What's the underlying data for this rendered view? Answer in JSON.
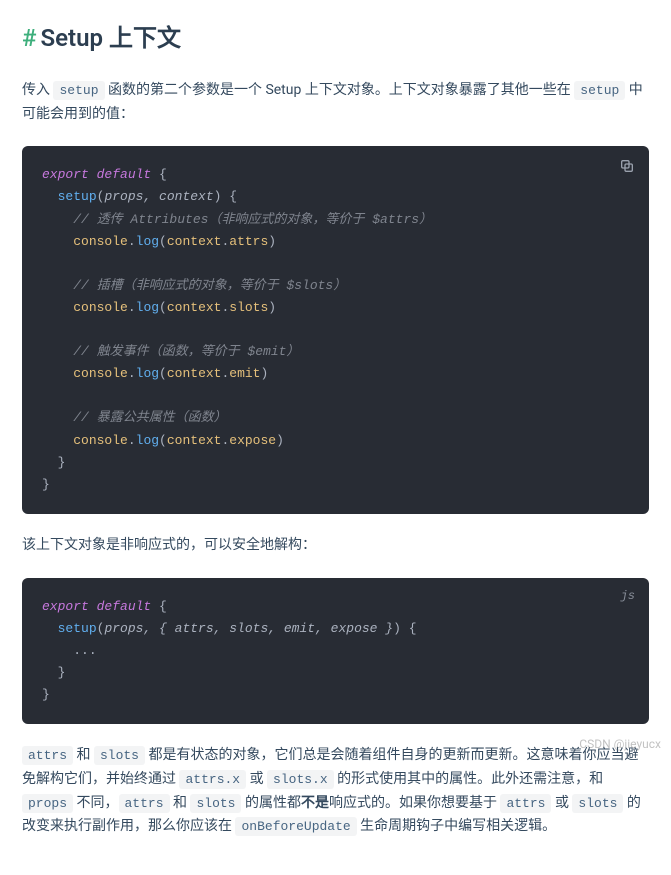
{
  "heading": {
    "anchor": "#",
    "text": "Setup 上下文"
  },
  "intro": {
    "part1": "传入 ",
    "code1": "setup",
    "part2": " 函数的第二个参数是一个 Setup 上下文对象。上下文对象暴露了其他一些在 ",
    "code2": "setup",
    "part3": " 中可能会用到的值："
  },
  "code_block_1": {
    "l1_kw1": "export",
    "l1_kw2": "default",
    "l1_p": " {",
    "l2_fn": "setup",
    "l2_po": "(",
    "l2_par": "props, context",
    "l2_pc": ")",
    "l2_b": " {",
    "c1": "// 透传 Attributes（非响应式的对象，等价于 $attrs）",
    "log": "console",
    "dot": ".",
    "logfn": "log",
    "po": "(",
    "ctx": "context",
    "attr": "attrs",
    "pc": ")",
    "c2": "// 插槽（非响应式的对象，等价于 $slots）",
    "slots": "slots",
    "c3": "// 触发事件（函数，等价于 $emit）",
    "emit": "emit",
    "c4": "// 暴露公共属性（函数）",
    "expose": "expose",
    "close_inner": "}",
    "close_outer": "}"
  },
  "para2": "该上下文对象是非响应式的，可以安全地解构：",
  "code_block_2": {
    "lang": "js",
    "l1_kw1": "export",
    "l1_kw2": "default",
    "l1_p": " {",
    "l2_fn": "setup",
    "l2_po": "(",
    "l2_par": "props, { attrs, slots, emit, expose }",
    "l2_pc": ")",
    "l2_b": " {",
    "body": "...",
    "close_inner": "}",
    "close_outer": "}"
  },
  "para3": {
    "c1": "attrs",
    "t1": " 和 ",
    "c2": "slots",
    "t2": " 都是有状态的对象，它们总是会随着组件自身的更新而更新。这意味着你应当避免解构它们，并始终通过 ",
    "c3": "attrs.x",
    "t3": " 或 ",
    "c4": "slots.x",
    "t4": " 的形式使用其中的属性。此外还需注意，和 ",
    "c5": "props",
    "t5": " 不同，",
    "c6": "attrs",
    "t6": " 和 ",
    "c7": "slots",
    "t7": " 的属性都",
    "b1": "不是",
    "t8": "响应式的。如果你想要基于 ",
    "c8": "attrs",
    "t9": " 或 ",
    "c9": "slots",
    "t10": " 的改变来执行副作用，那么你应该在 ",
    "c10": "onBeforeUpdate",
    "t11": " 生命周期钩子中编写相关逻辑。"
  },
  "watermark": "CSDN @jieyucx"
}
